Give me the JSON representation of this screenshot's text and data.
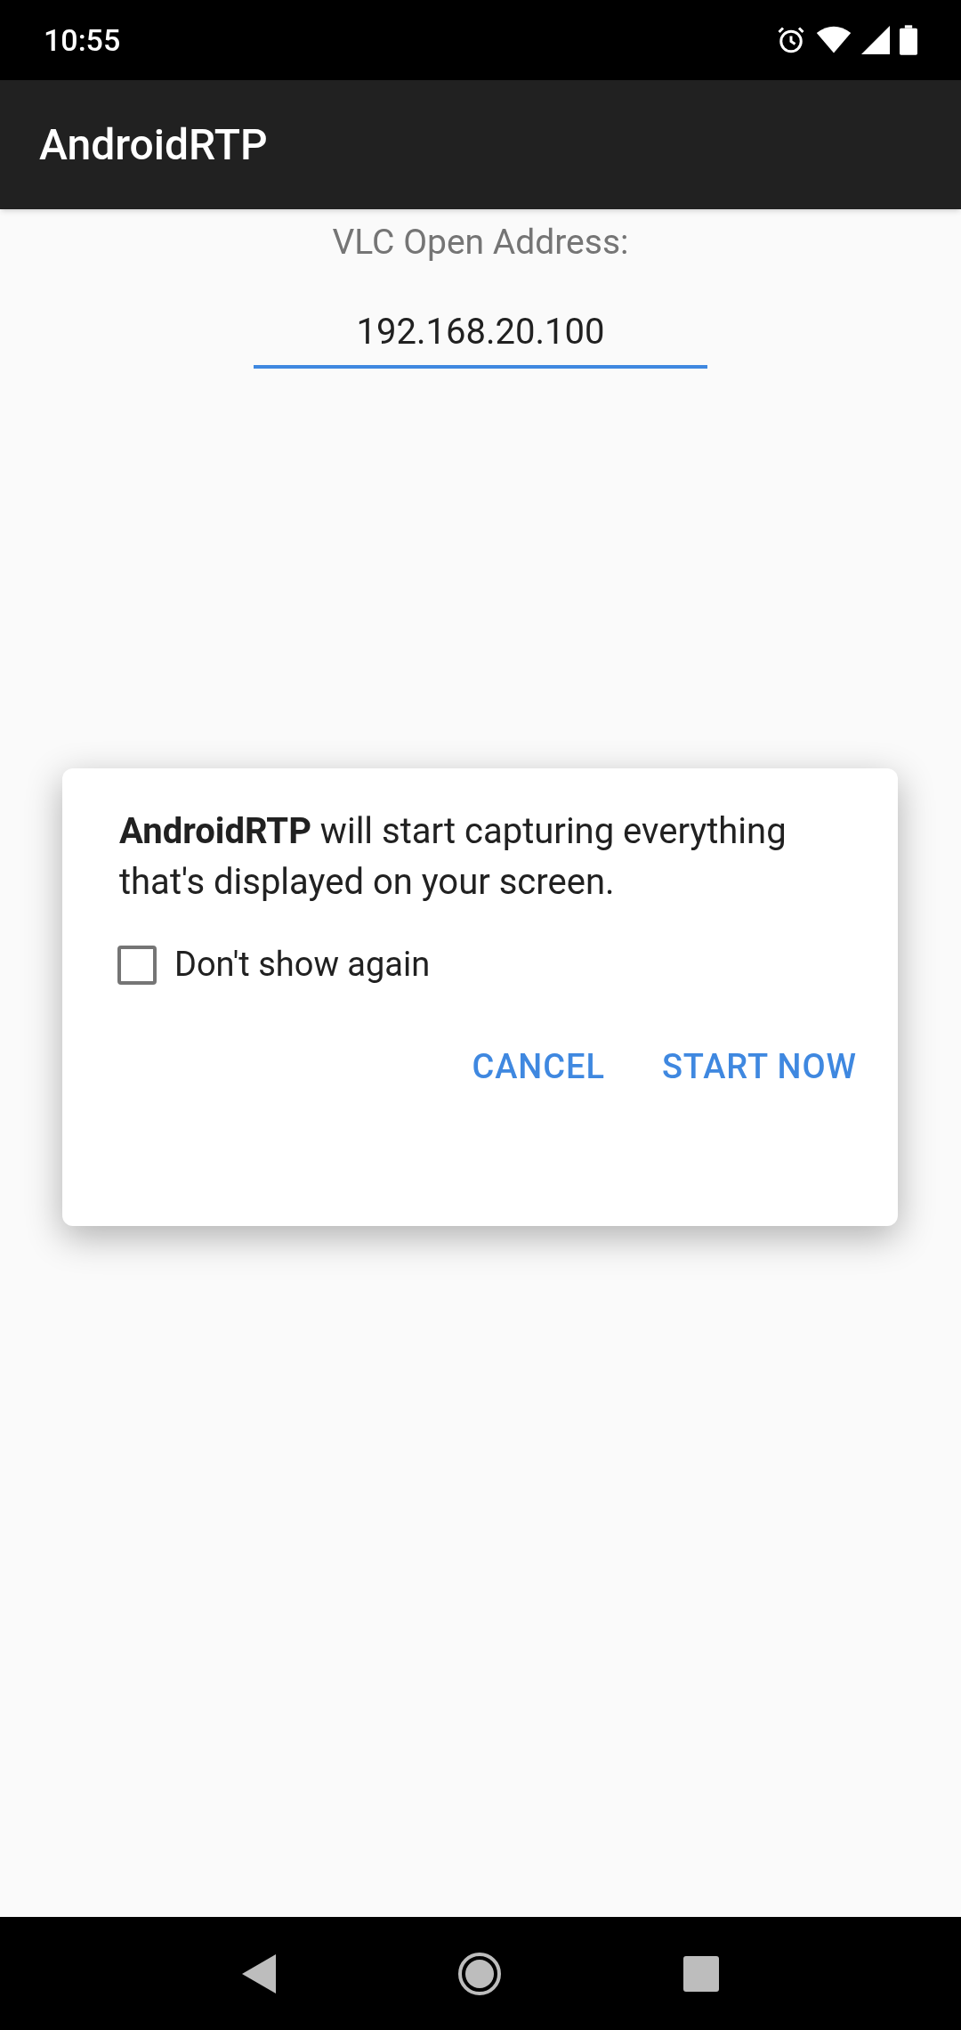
{
  "status_bar": {
    "time": "10:55"
  },
  "app_bar": {
    "title": "AndroidRTP"
  },
  "address_label": "VLC Open Address:",
  "address_field": {
    "value": "192.168.20.100",
    "focused": true
  },
  "dialog": {
    "message": "**AndroidRTP** will start capturing everything that's displayed on your screen.",
    "checkbox": {
      "label": "Don't show again",
      "checked": false
    },
    "buttons": [
      {
        "label": "CANCEL"
      },
      {
        "label": "START NOW"
      }
    ]
  }
}
